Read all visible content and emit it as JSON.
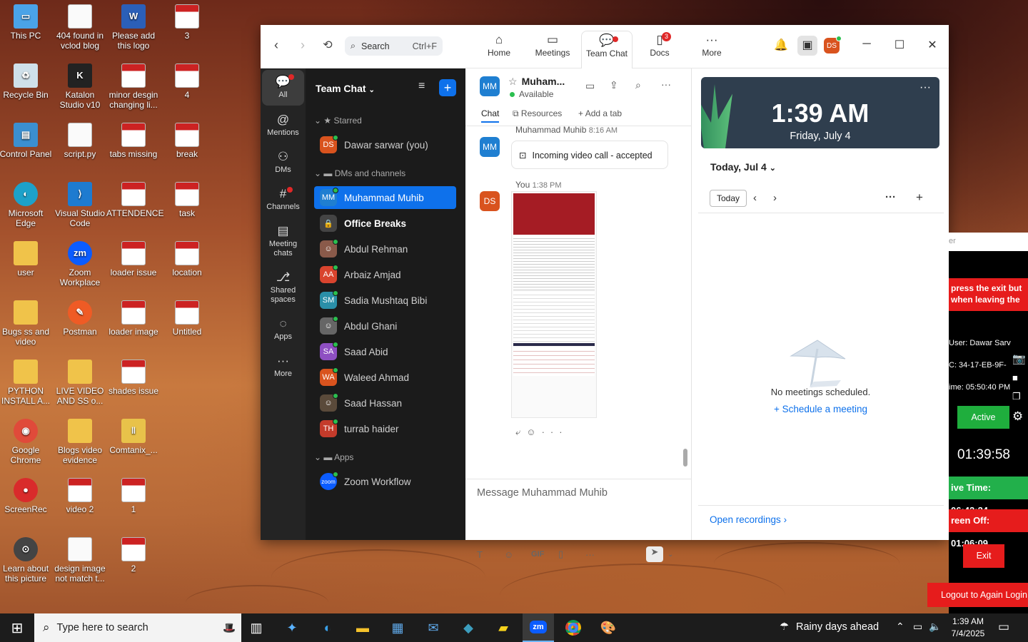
{
  "desktop_icons": [
    {
      "label": "This PC",
      "icon": "pc-icon"
    },
    {
      "label": "404 found in vclod blog",
      "icon": "doc-icon"
    },
    {
      "label": "Please add this logo",
      "icon": "word-icon"
    },
    {
      "label": "3",
      "icon": "image-icon"
    },
    {
      "label": "Recycle Bin",
      "icon": "recycle-icon"
    },
    {
      "label": "Katalon Studio v10",
      "icon": "katalon-icon"
    },
    {
      "label": "minor desgin changing li...",
      "icon": "image-icon"
    },
    {
      "label": "4",
      "icon": "image-icon"
    },
    {
      "label": "Control Panel",
      "icon": "control-panel-icon"
    },
    {
      "label": "script.py",
      "icon": "doc-icon"
    },
    {
      "label": "tabs missing",
      "icon": "image-icon"
    },
    {
      "label": "break",
      "icon": "image-icon"
    },
    {
      "label": "Microsoft Edge",
      "icon": "edge-icon"
    },
    {
      "label": "Visual Studio Code",
      "icon": "vscode-icon"
    },
    {
      "label": "ATTENDENCE",
      "icon": "image-icon"
    },
    {
      "label": "task",
      "icon": "image-icon"
    },
    {
      "label": "user",
      "icon": "folder-icon"
    },
    {
      "label": "Zoom Workplace",
      "icon": "zoom-icon"
    },
    {
      "label": "loader issue",
      "icon": "image-icon"
    },
    {
      "label": "location",
      "icon": "image-icon"
    },
    {
      "label": "Bugs ss and video",
      "icon": "folder-icon"
    },
    {
      "label": "Postman",
      "icon": "postman-icon"
    },
    {
      "label": "loader image",
      "icon": "image-icon"
    },
    {
      "label": "Untitled",
      "icon": "image-icon"
    },
    {
      "label": "PYTHON INSTALL A...",
      "icon": "folder-icon"
    },
    {
      "label": "LIVE VIDEO AND SS o...",
      "icon": "folder-icon"
    },
    {
      "label": "shades issue",
      "icon": "image-icon"
    },
    {
      "label": "Google Chrome",
      "icon": "chrome-icon"
    },
    {
      "label": "Blogs video evidence",
      "icon": "folder-icon"
    },
    {
      "label": "Comtanix_...",
      "icon": "zip-icon"
    },
    {
      "label": "ScreenRec",
      "icon": "screenrec-icon"
    },
    {
      "label": "video 2",
      "icon": "image-icon"
    },
    {
      "label": "1",
      "icon": "image-icon"
    },
    {
      "label": "Learn about this picture",
      "icon": "camera-icon"
    },
    {
      "label": "design image not match t...",
      "icon": "doc-icon"
    },
    {
      "label": "2",
      "icon": "image-icon"
    }
  ],
  "zoom": {
    "search_placeholder": "Search",
    "search_shortcut": "Ctrl+F",
    "tabs": [
      {
        "label": "Home"
      },
      {
        "label": "Meetings"
      },
      {
        "label": "Team Chat"
      },
      {
        "label": "Docs",
        "badge": "3"
      },
      {
        "label": "More"
      }
    ],
    "profile_initials": "DS",
    "rail": [
      {
        "label": "All"
      },
      {
        "label": "Mentions"
      },
      {
        "label": "DMs"
      },
      {
        "label": "Channels"
      },
      {
        "label": "Meeting chats"
      },
      {
        "label": "Shared spaces"
      },
      {
        "label": "Apps"
      },
      {
        "label": "More"
      }
    ],
    "list_title": "Team Chat",
    "starred_label": "Starred",
    "dms_label": "DMs and channels",
    "apps_label": "Apps",
    "starred": [
      {
        "initials": "DS",
        "name": "Dawar sarwar (you)",
        "color": "#d9531e"
      }
    ],
    "dms": [
      {
        "initials": "MM",
        "name": "Muhammad Muhib",
        "color": "#1f7fd1"
      },
      {
        "initials": "",
        "name": "Office Breaks",
        "color": "#444"
      },
      {
        "initials": "",
        "name": "Abdul Rehman",
        "color": "#8a5a4a"
      },
      {
        "initials": "AA",
        "name": "Arbaiz Amjad",
        "color": "#d9442e"
      },
      {
        "initials": "SM",
        "name": "Sadia Mushtaq Bibi",
        "color": "#2a8fa8"
      },
      {
        "initials": "",
        "name": "Abdul Ghani",
        "color": "#666"
      },
      {
        "initials": "SA",
        "name": "Saad Abid",
        "color": "#8e4fc2"
      },
      {
        "initials": "WA",
        "name": "Waleed Ahmad",
        "color": "#d9531e"
      },
      {
        "initials": "",
        "name": "Saad Hassan",
        "color": "#5a4a3a"
      },
      {
        "initials": "TH",
        "name": "turrab haider",
        "color": "#c43b2b"
      }
    ],
    "apps": [
      {
        "initials": "zoom",
        "name": "Zoom Workflow",
        "color": "#0b5cff"
      }
    ],
    "chat": {
      "contact_initials": "MM",
      "contact_name": "Muham...",
      "status": "Available",
      "tab_chat": "Chat",
      "tab_resources": "Resources",
      "tab_add": "Add a tab",
      "msg1_sender": "Muhammad Muhib",
      "msg1_time": "8:16 AM",
      "msg1_text": "Incoming video call - accepted",
      "msg2_sender": "You",
      "msg2_time": "1:38 PM",
      "msg2_initials": "DS",
      "input_placeholder": "Message Muhammad Muhib",
      "tool_gif": "GIF"
    },
    "calendar": {
      "time": "1:39 AM",
      "date": "Friday, July 4",
      "day_label": "Today, Jul 4",
      "today_button": "Today",
      "empty_text": "No meetings scheduled.",
      "schedule_link": "Schedule a meeting",
      "recordings_link": "Open recordings"
    }
  },
  "overlay": {
    "top_text": "er",
    "banner": "press the exit but when leaving the",
    "user": "User: Dawar Sarv",
    "mac": "C: 34-17-EB-9F-",
    "time_label": "ime: 05:50:40 PM",
    "active_btn": "Active",
    "clock": "01:39:58",
    "active_time": "ive Time: 06:42:24",
    "screen_off": "reen Off: 01:06:09",
    "exit_btn": "Exit",
    "logout_btn": "Logout to Again Login"
  },
  "taskbar": {
    "search_placeholder": "Type here to search",
    "weather": "Rainy days ahead",
    "time": "1:39 AM",
    "date": "7/4/2025"
  }
}
